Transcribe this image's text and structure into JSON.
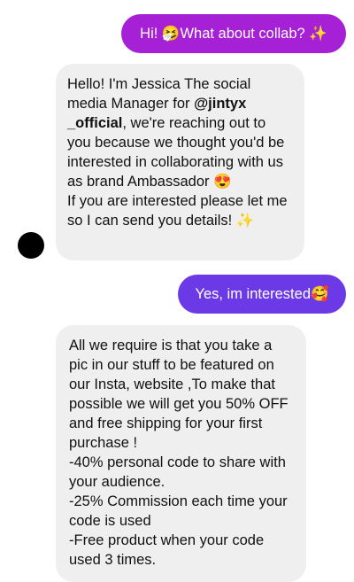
{
  "messages": {
    "m1": {
      "sender": "me",
      "text": "Hi! 🤧What about collab? ✨",
      "color": "#a621d6"
    },
    "m2": {
      "sender": "them",
      "text_a": "Hello! I'm Jessica The social media Manager for ",
      "mention": "@jintyx _official",
      "text_b": ", we're reaching out to you because we thought you'd be interested in collaborating with us as brand Ambassador 😍\nIf you are interested please let me so I can send you details! ✨"
    },
    "m3": {
      "sender": "me",
      "text": "Yes, im interested🥰",
      "color": "#6b3ae6"
    },
    "m4": {
      "sender": "them",
      "text": "All we require is that you take a pic in our  stuff to be featured on our Insta, website ,To make that possible we will get you 50% OFF and free shipping  for your first purchase !\n-40% personal code to share with your audience.\n-25% Commission each time your code is used\n-Free product when your code used 3 times."
    }
  },
  "avatar": {
    "color": "#000000"
  }
}
